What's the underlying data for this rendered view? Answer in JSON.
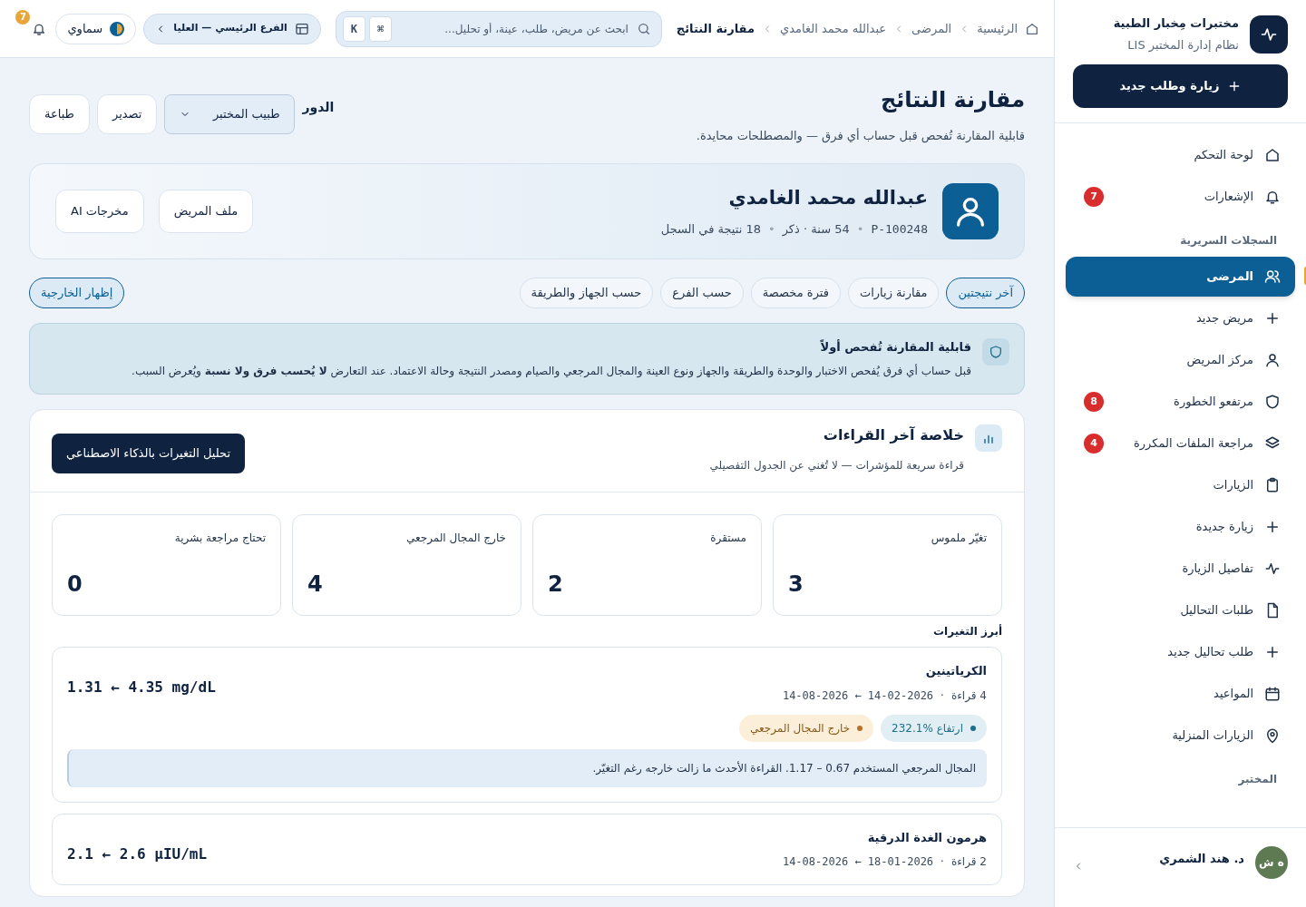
{
  "sidebar": {
    "brand": {
      "title": "مختبرات مِخبار الطبية",
      "subtitle": "نظام إدارة المختبر LIS"
    },
    "primary_button": "زيارة وطلب جديد",
    "sections": [
      {
        "items": [
          {
            "label": "لوحة التحكم",
            "selected": false
          },
          {
            "label": "الإشعارات",
            "selected": false,
            "badge": "7"
          }
        ]
      },
      {
        "heading": "السجلات السريرية",
        "items": [
          {
            "label": "المرضى",
            "selected": true
          },
          {
            "label": "مريض جديد",
            "selected": false
          },
          {
            "label": "مركز المريض",
            "selected": false
          },
          {
            "label": "مرتفعو الخطورة",
            "selected": false,
            "badge": "8"
          },
          {
            "label": "مراجعة الملفات المكررة",
            "selected": false,
            "badge": "4"
          },
          {
            "label": "الزيارات",
            "selected": false
          },
          {
            "label": "زيارة جديدة",
            "selected": false
          },
          {
            "label": "تفاصيل الزيارة",
            "selected": false
          },
          {
            "label": "طلبات التحاليل",
            "selected": false
          },
          {
            "label": "طلب تحاليل جديد",
            "selected": false
          },
          {
            "label": "المواعيد",
            "selected": false
          },
          {
            "label": "الزيارات المنزلية",
            "selected": false
          }
        ]
      },
      {
        "heading": "المختبر"
      }
    ],
    "user": {
      "name": "د. هند الشمري",
      "initials": "ه ش"
    }
  },
  "topbar": {
    "breadcrumbs": [
      {
        "label": "الرئيسية",
        "current": false
      },
      {
        "label": "المرضى",
        "current": false
      },
      {
        "label": "عبدالله محمد الغامدي",
        "current": false
      },
      {
        "label": "مقارنة النتائج",
        "current": true
      }
    ],
    "search": {
      "placeholder": "ابحث عن مريض، طلب، عينة، أو تحليل..."
    },
    "keys": [
      "⌘",
      "K"
    ],
    "branch": "الفرع الرئيسي — العليا",
    "theme": "سماوي",
    "notifications": "7"
  },
  "header": {
    "title": "مقارنة النتائج",
    "subtitle": "قابلية المقارنة تُفحص قبل حساب أي فرق — والمصطلحات محايدة.",
    "role_label": "الدور",
    "role": "طبيب المختبر",
    "buttons": [
      "تصدير",
      "طباعة"
    ]
  },
  "patient": {
    "name": "عبدالله محمد الغامدي",
    "id": "P-100248",
    "separator": "•",
    "meta": "54 سنة · ذكر",
    "count": "18 نتيجة في السجل",
    "buttons": [
      "ملف المريض",
      "مخرجات AI"
    ]
  },
  "tabs": [
    {
      "label": "آخر نتيجتين",
      "selected": true
    },
    {
      "label": "مقارنة زيارات",
      "selected": false
    },
    {
      "label": "فترة مخصصة",
      "selected": false
    },
    {
      "label": "حسب الفرع",
      "selected": false
    },
    {
      "label": "حسب الجهاز والطريقة",
      "selected": false
    }
  ],
  "outliers_toggle": {
    "label": "إظهار الخارجية",
    "on": true
  },
  "notice": {
    "title": "قابلية المقارنة تُفحص أولاً",
    "body": "قبل حساب أي فرق يُفحص الاختبار والوحدة والطريقة والجهاز ونوع العينة والمجال المرجعي والصيام ومصدر النتيجة وحالة الاعتماد. عند التعارض **لا يُحسب فرق ولا نسبة** ويُعرض السبب."
  },
  "summary": {
    "title": "خلاصة آخر القراءات",
    "subtitle": "قراءة سريعة للمؤشرات — لا تُغني عن الجدول التفصيلي",
    "ai_button": "تحليل التغيرات بالذكاء الاصطناعي",
    "stats": [
      {
        "label": "تغيّر ملموس",
        "value": "3"
      },
      {
        "label": "مستقرة",
        "value": "2"
      },
      {
        "label": "خارج المجال المرجعي",
        "value": "4"
      },
      {
        "label": "تحتاج مراجعة بشرية",
        "value": "0"
      }
    ],
    "highlights_heading": "أبرز التغيرات",
    "changes": [
      {
        "name": "الكرياتينين",
        "range": "1.31 ← 4.35 mg/dL",
        "count": "4 قراءة",
        "separator": "·",
        "dates": "14-08-2026 ← 14-02-2026",
        "tags": [
          {
            "label": "ارتفاع %232.1",
            "color": "#1e6f8a"
          },
          {
            "label": "خارج المجال المرجعي",
            "color": "#b7702a"
          }
        ],
        "note": "المجال المرجعي المستخدم 0.67 – 1.17. القراءة الأحدث ما زالت خارجه رغم التغيّر."
      },
      {
        "name": "هرمون الغدة الدرقية",
        "range": "2.1 ← 2.6 µIU/mL",
        "count": "2 قراءة",
        "separator": "·",
        "dates": "14-08-2026 ← 18-01-2026"
      }
    ]
  }
}
